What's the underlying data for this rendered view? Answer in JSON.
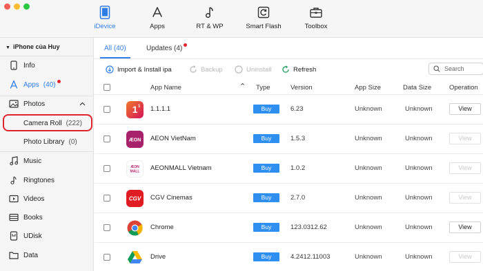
{
  "nav": {
    "items": [
      {
        "label": "iDevice",
        "icon": "phone-icon"
      },
      {
        "label": "Apps",
        "icon": "app-store-icon"
      },
      {
        "label": "RT & WP",
        "icon": "music-note-icon"
      },
      {
        "label": "Smart Flash",
        "icon": "refresh-icon"
      },
      {
        "label": "Toolbox",
        "icon": "toolbox-icon"
      }
    ],
    "active_color": "#2f7ee8"
  },
  "sidebar": {
    "device_name": "iPhone của Huy",
    "items": [
      {
        "label": "Info",
        "icon": "phone-outline-icon"
      },
      {
        "label": "Apps",
        "count": "(40)",
        "icon": "app-store-icon"
      },
      {
        "label": "Photos",
        "icon": "photo-icon"
      },
      {
        "label": "Camera Roll",
        "count": "(222)"
      },
      {
        "label": "Photo Library",
        "count": "(0)"
      },
      {
        "label": "Music",
        "icon": "music-icon"
      },
      {
        "label": "Ringtones",
        "icon": "bell-note-icon"
      },
      {
        "label": "Videos",
        "icon": "video-icon"
      },
      {
        "label": "Books",
        "icon": "books-icon"
      },
      {
        "label": "UDisk",
        "icon": "udisk-icon"
      },
      {
        "label": "Data",
        "icon": "folder-icon"
      }
    ]
  },
  "tabs": {
    "all": "All (40)",
    "updates": "Updates (4)"
  },
  "toolbar": {
    "import": "Import & Install ipa",
    "backup": "Backup",
    "uninstall": "Uninstall",
    "refresh": "Refresh",
    "search_placeholder": "Search"
  },
  "table": {
    "headers": {
      "app_name": "App Name",
      "type": "Type",
      "version": "Version",
      "app_size": "App Size",
      "data_size": "Data Size",
      "operation": "Operation"
    },
    "rows": [
      {
        "name": "1.1.1.1",
        "type": "Buy",
        "version": "6.23",
        "app_size": "Unknown",
        "data_size": "Unknown",
        "operation": "View",
        "enabled": true,
        "icon": "cloudflare-1111-icon"
      },
      {
        "name": "AEON VietNam",
        "type": "Buy",
        "version": "1.5.3",
        "app_size": "Unknown",
        "data_size": "Unknown",
        "operation": "View",
        "enabled": false,
        "icon": "aeon-icon"
      },
      {
        "name": "AEONMALL Vietnam",
        "type": "Buy",
        "version": "1.0.2",
        "app_size": "Unknown",
        "data_size": "Unknown",
        "operation": "View",
        "enabled": false,
        "icon": "aeonmall-icon"
      },
      {
        "name": "CGV Cinemas",
        "type": "Buy",
        "version": "2.7.0",
        "app_size": "Unknown",
        "data_size": "Unknown",
        "operation": "View",
        "enabled": false,
        "icon": "cgv-icon"
      },
      {
        "name": "Chrome",
        "type": "Buy",
        "version": "123.0312.62",
        "app_size": "Unknown",
        "data_size": "Unknown",
        "operation": "View",
        "enabled": true,
        "icon": "chrome-icon"
      },
      {
        "name": "Drive",
        "type": "Buy",
        "version": "4.2412.11003",
        "app_size": "Unknown",
        "data_size": "Unknown",
        "operation": "View",
        "enabled": false,
        "icon": "google-drive-icon"
      }
    ]
  }
}
